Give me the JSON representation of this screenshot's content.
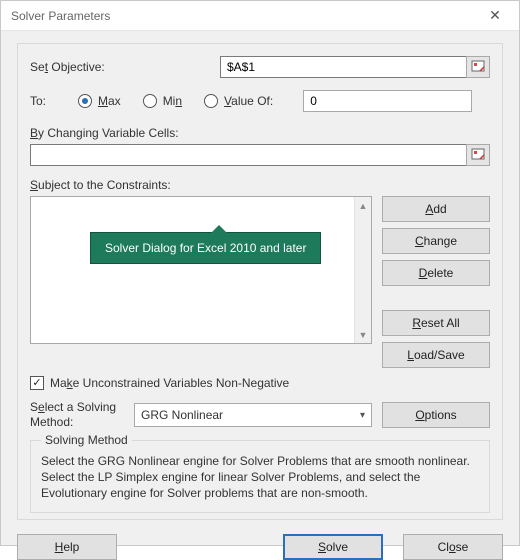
{
  "window": {
    "title": "Solver Parameters"
  },
  "objective": {
    "label_pre": "Se",
    "label_u": "t",
    "label_post": " Objective:",
    "value": "$A$1"
  },
  "to": {
    "label": "To:",
    "max_u": "M",
    "max_post": "ax",
    "min_pre": "Mi",
    "min_u": "n",
    "valueof_u": "V",
    "valueof_post": "alue Of:",
    "value_of_value": "0",
    "selected": "max"
  },
  "changing": {
    "label_u": "B",
    "label_post": "y Changing Variable Cells:",
    "value": ""
  },
  "constraints": {
    "label_u": "S",
    "label_mid": "ubject to the Constraints:",
    "items": []
  },
  "buttons": {
    "add_u": "A",
    "add_post": "dd",
    "change_u": "C",
    "change_post": "hange",
    "delete_u": "D",
    "delete_post": "elete",
    "resetall_u": "R",
    "resetall_post": "eset All",
    "loadsave_u": "L",
    "loadsave_post": "oad/Save",
    "options_u": "O",
    "options_post": "ptions",
    "help_u": "H",
    "help_post": "elp",
    "solve_u": "S",
    "solve_post": "olve",
    "close_pre": "Cl",
    "close_u": "o",
    "close_post": "se"
  },
  "checkbox": {
    "pre": "Ma",
    "u": "k",
    "post": "e Unconstrained Variables Non-Negative",
    "checked": true
  },
  "method": {
    "label_pre": "S",
    "label_u": "e",
    "label_post": "lect a Solving Method:",
    "selected": "GRG Nonlinear"
  },
  "desc": {
    "title": "Solving Method",
    "text": "Select the GRG Nonlinear engine for Solver Problems that are smooth nonlinear. Select the LP Simplex engine for linear Solver Problems, and select the Evolutionary engine for Solver problems that are non-smooth."
  },
  "callout": {
    "text": "Solver Dialog for Excel 2010 and later"
  }
}
